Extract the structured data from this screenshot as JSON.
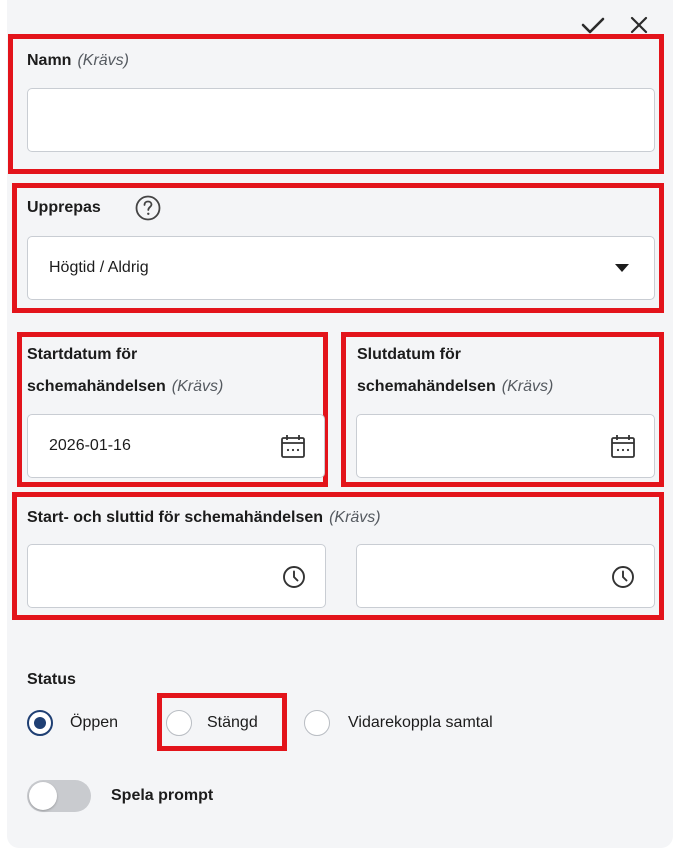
{
  "header": {
    "confirm_icon": "check-icon",
    "close_icon": "close-icon"
  },
  "name_field": {
    "label": "Namn",
    "required": "(Krävs)",
    "value": ""
  },
  "repeat_field": {
    "label": "Upprepas",
    "help_icon": "question-circle-icon",
    "value": "Högtid / Aldrig",
    "dropdown_icon": "caret-down-icon"
  },
  "start_date": {
    "label_line1": "Startdatum för",
    "label_line2": "schemahändelsen",
    "required": "(Krävs)",
    "value": "2026-01-16",
    "icon": "calendar-icon"
  },
  "end_date": {
    "label_line1": "Slutdatum för",
    "label_line2": "schemahändelsen",
    "required": "(Krävs)",
    "value": "",
    "icon": "calendar-icon"
  },
  "time_range": {
    "label": "Start- och sluttid för schemahändelsen",
    "required": "(Krävs)",
    "start_value": "",
    "end_value": "",
    "icon": "clock-icon"
  },
  "status": {
    "label": "Status",
    "options": [
      {
        "label": "Öppen",
        "checked": true
      },
      {
        "label": "Stängd",
        "checked": false
      },
      {
        "label": "Vidarekoppla samtal",
        "checked": false
      }
    ]
  },
  "prompt_toggle": {
    "label": "Spela prompt",
    "on": false
  },
  "colors": {
    "highlight": "#e3141b",
    "radio_selected": "#1f3f73",
    "panel_bg": "#f4f5f7"
  }
}
